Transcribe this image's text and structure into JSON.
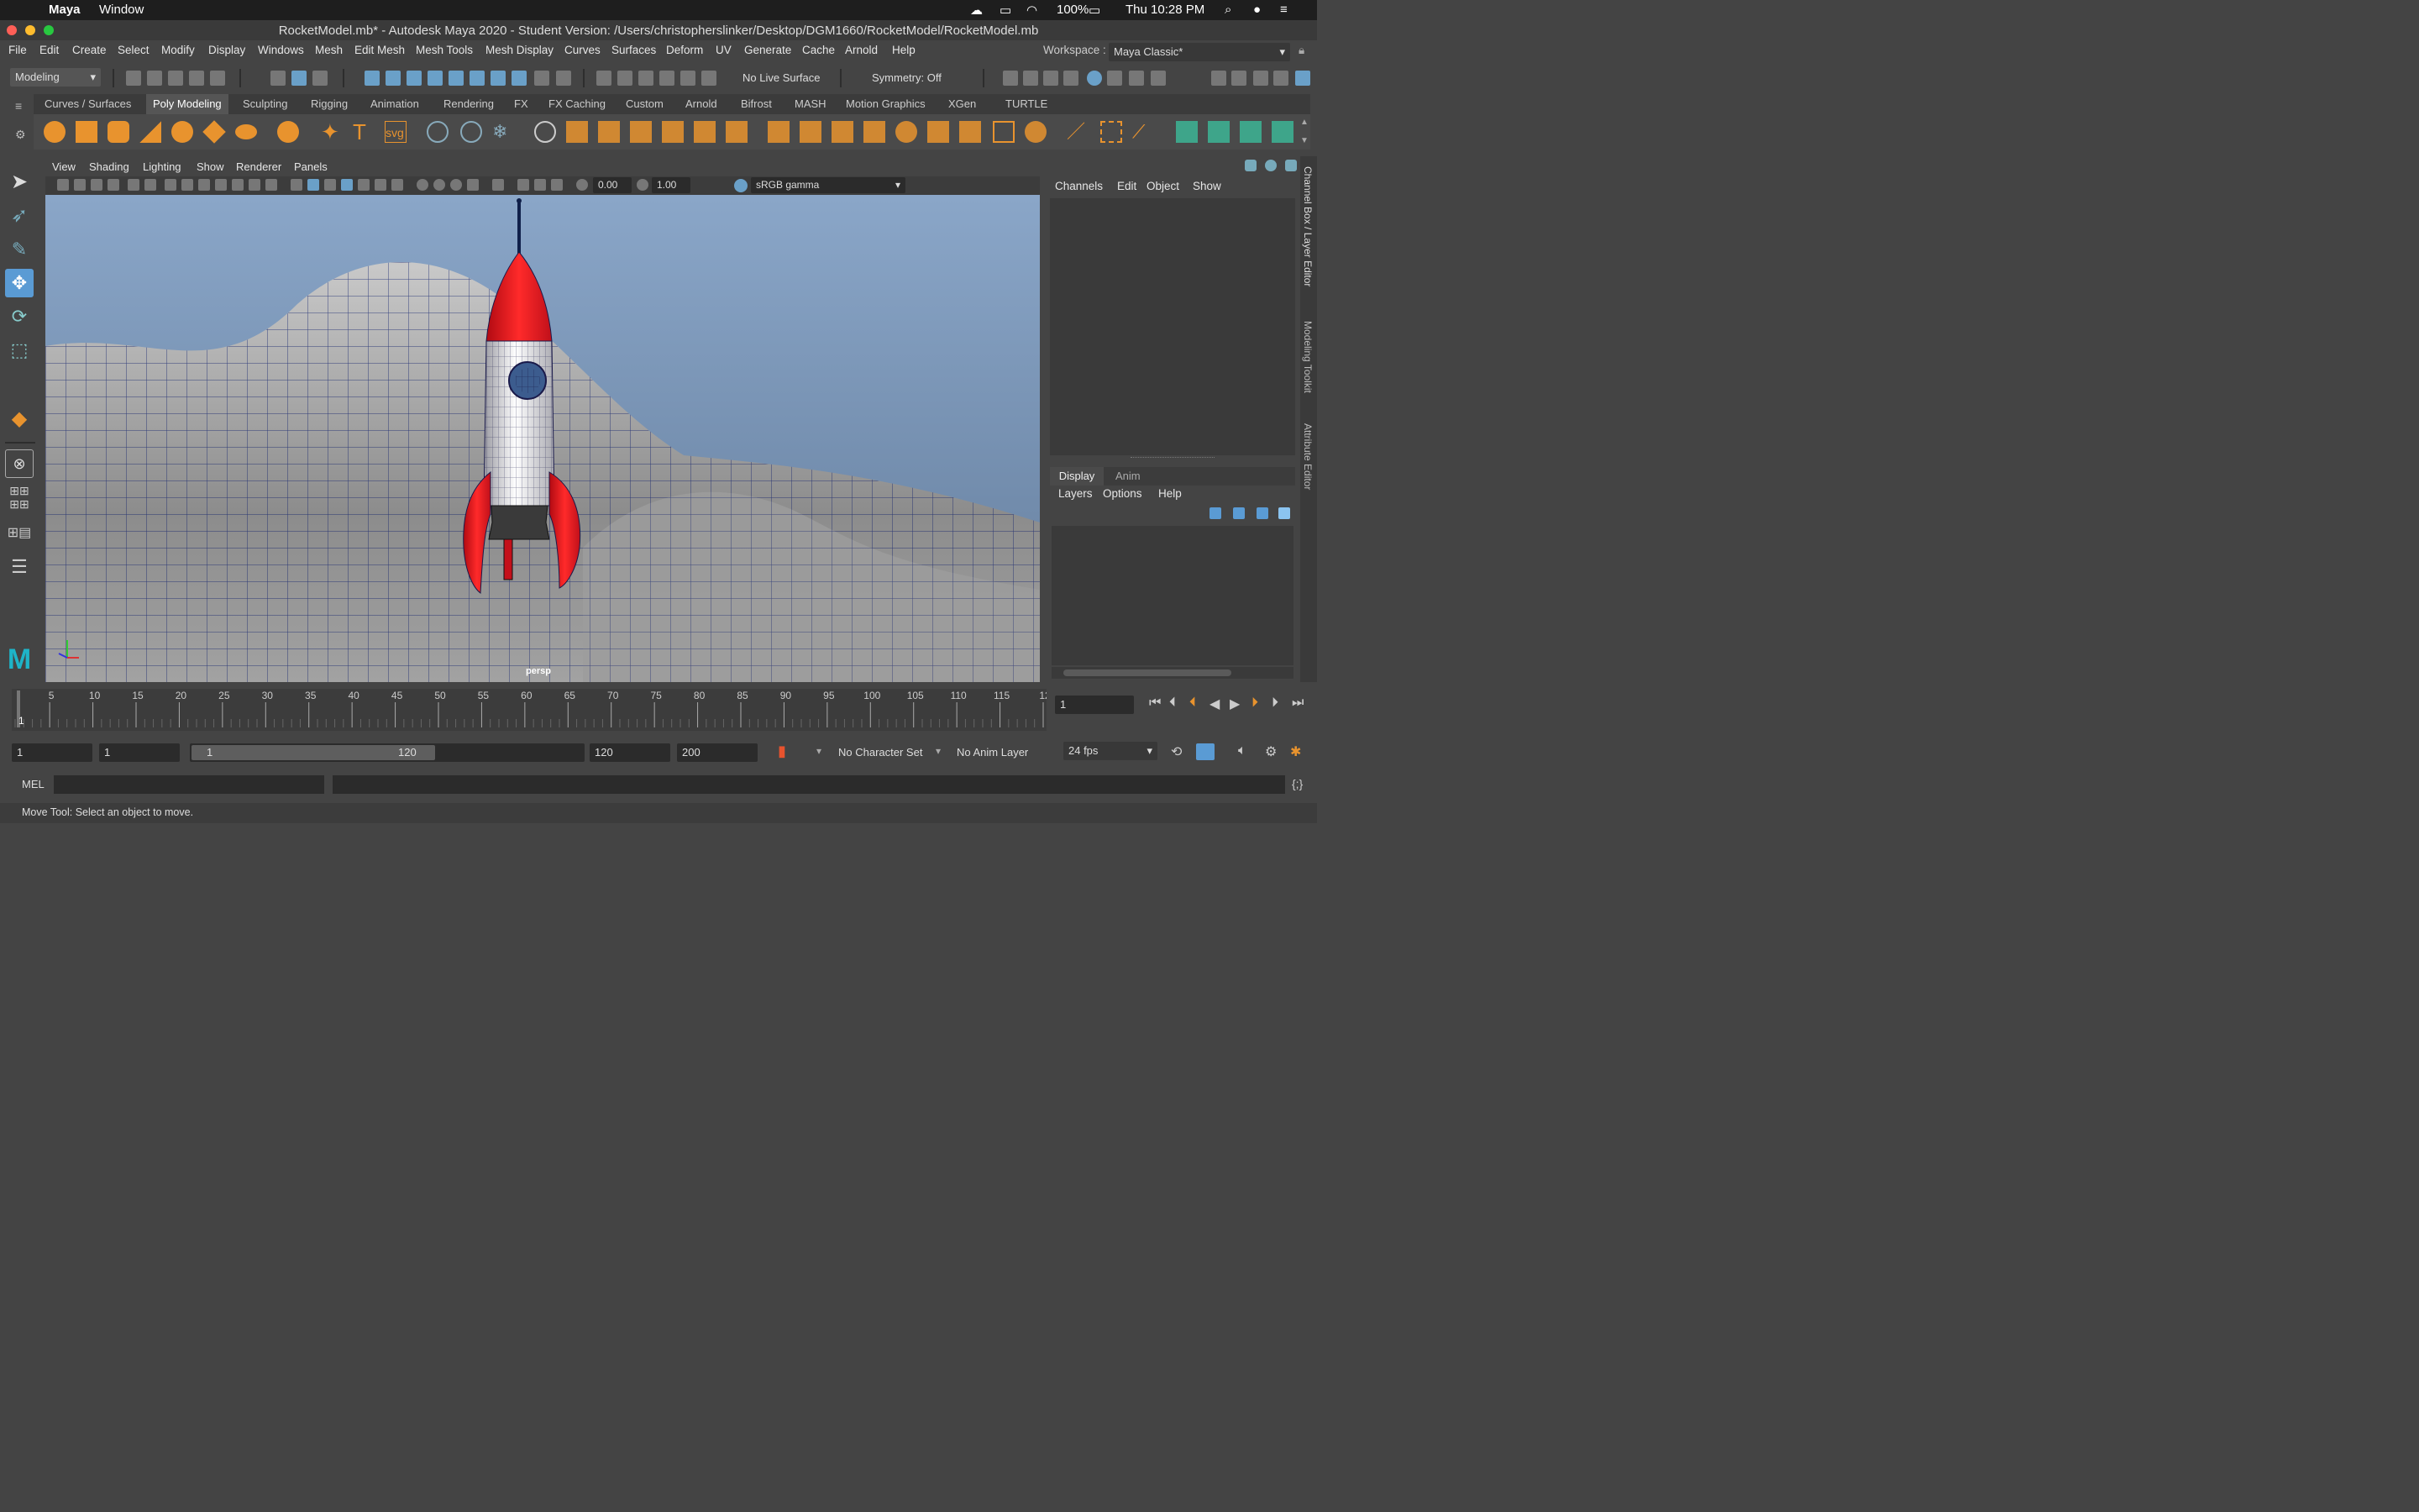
{
  "macbar": {
    "app": "Maya",
    "menu_window": "Window",
    "battery": "100%",
    "clock": "Thu 10:28 PM"
  },
  "window": {
    "title": "RocketModel.mb* - Autodesk Maya 2020 - Student Version: /Users/christopherslinker/Desktop/DGM1660/RocketModel/RocketModel.mb"
  },
  "menus": [
    "File",
    "Edit",
    "Create",
    "Select",
    "Modify",
    "Display",
    "Windows",
    "Mesh",
    "Edit Mesh",
    "Mesh Tools",
    "Mesh Display",
    "Curves",
    "Surfaces",
    "Deform",
    "UV",
    "Generate",
    "Cache",
    "Arnold",
    "Help"
  ],
  "workspace": {
    "label": "Workspace :",
    "value": "Maya Classic*"
  },
  "statusline": {
    "menuset": "Modeling",
    "live_surface": "No Live Surface",
    "symmetry": "Symmetry: Off"
  },
  "shelf_tabs": [
    "Curves / Surfaces",
    "Poly Modeling",
    "Sculpting",
    "Rigging",
    "Animation",
    "Rendering",
    "FX",
    "FX Caching",
    "Custom",
    "Arnold",
    "Bifrost",
    "MASH",
    "Motion Graphics",
    "XGen",
    "TURTLE"
  ],
  "active_shelf_tab": "Poly Modeling",
  "viewport": {
    "menus": [
      "View",
      "Shading",
      "Lighting",
      "Show",
      "Renderer",
      "Panels"
    ],
    "exposure": "0.00",
    "gamma": "1.00",
    "color_space": "sRGB gamma",
    "camera": "persp"
  },
  "channel_box": {
    "menus": [
      "Channels",
      "Edit",
      "Object",
      "Show"
    ]
  },
  "layer_editor": {
    "tabs": [
      "Display",
      "Anim"
    ],
    "menus": [
      "Layers",
      "Options",
      "Help"
    ]
  },
  "side_tabs": [
    "Channel Box / Layer Editor",
    "Modeling Toolkit",
    "Attribute Editor"
  ],
  "timeline": {
    "ticks": [
      "5",
      "10",
      "15",
      "20",
      "25",
      "30",
      "35",
      "40",
      "45",
      "50",
      "55",
      "60",
      "65",
      "70",
      "75",
      "80",
      "85",
      "90",
      "95",
      "100",
      "105",
      "110",
      "115",
      "12"
    ],
    "current_frame_label": "1",
    "current_frame_field": "1"
  },
  "range": {
    "start": "1",
    "anim_start": "1",
    "slider_start": "1",
    "slider_end": "120",
    "end": "120",
    "anim_end": "200",
    "character_set": "No Character Set",
    "anim_layer": "No Anim Layer",
    "fps": "24 fps"
  },
  "command": {
    "lang": "MEL"
  },
  "help_line": "Move Tool: Select an object to move.",
  "colors": {
    "accent_blue": "#5a9bd4",
    "shelf_orange": "#e8932e",
    "sky_top": "#8aa6c8",
    "sky_bottom": "#6e87a6",
    "rocket_red": "#d8141c",
    "wire": "#0a1a6a"
  }
}
